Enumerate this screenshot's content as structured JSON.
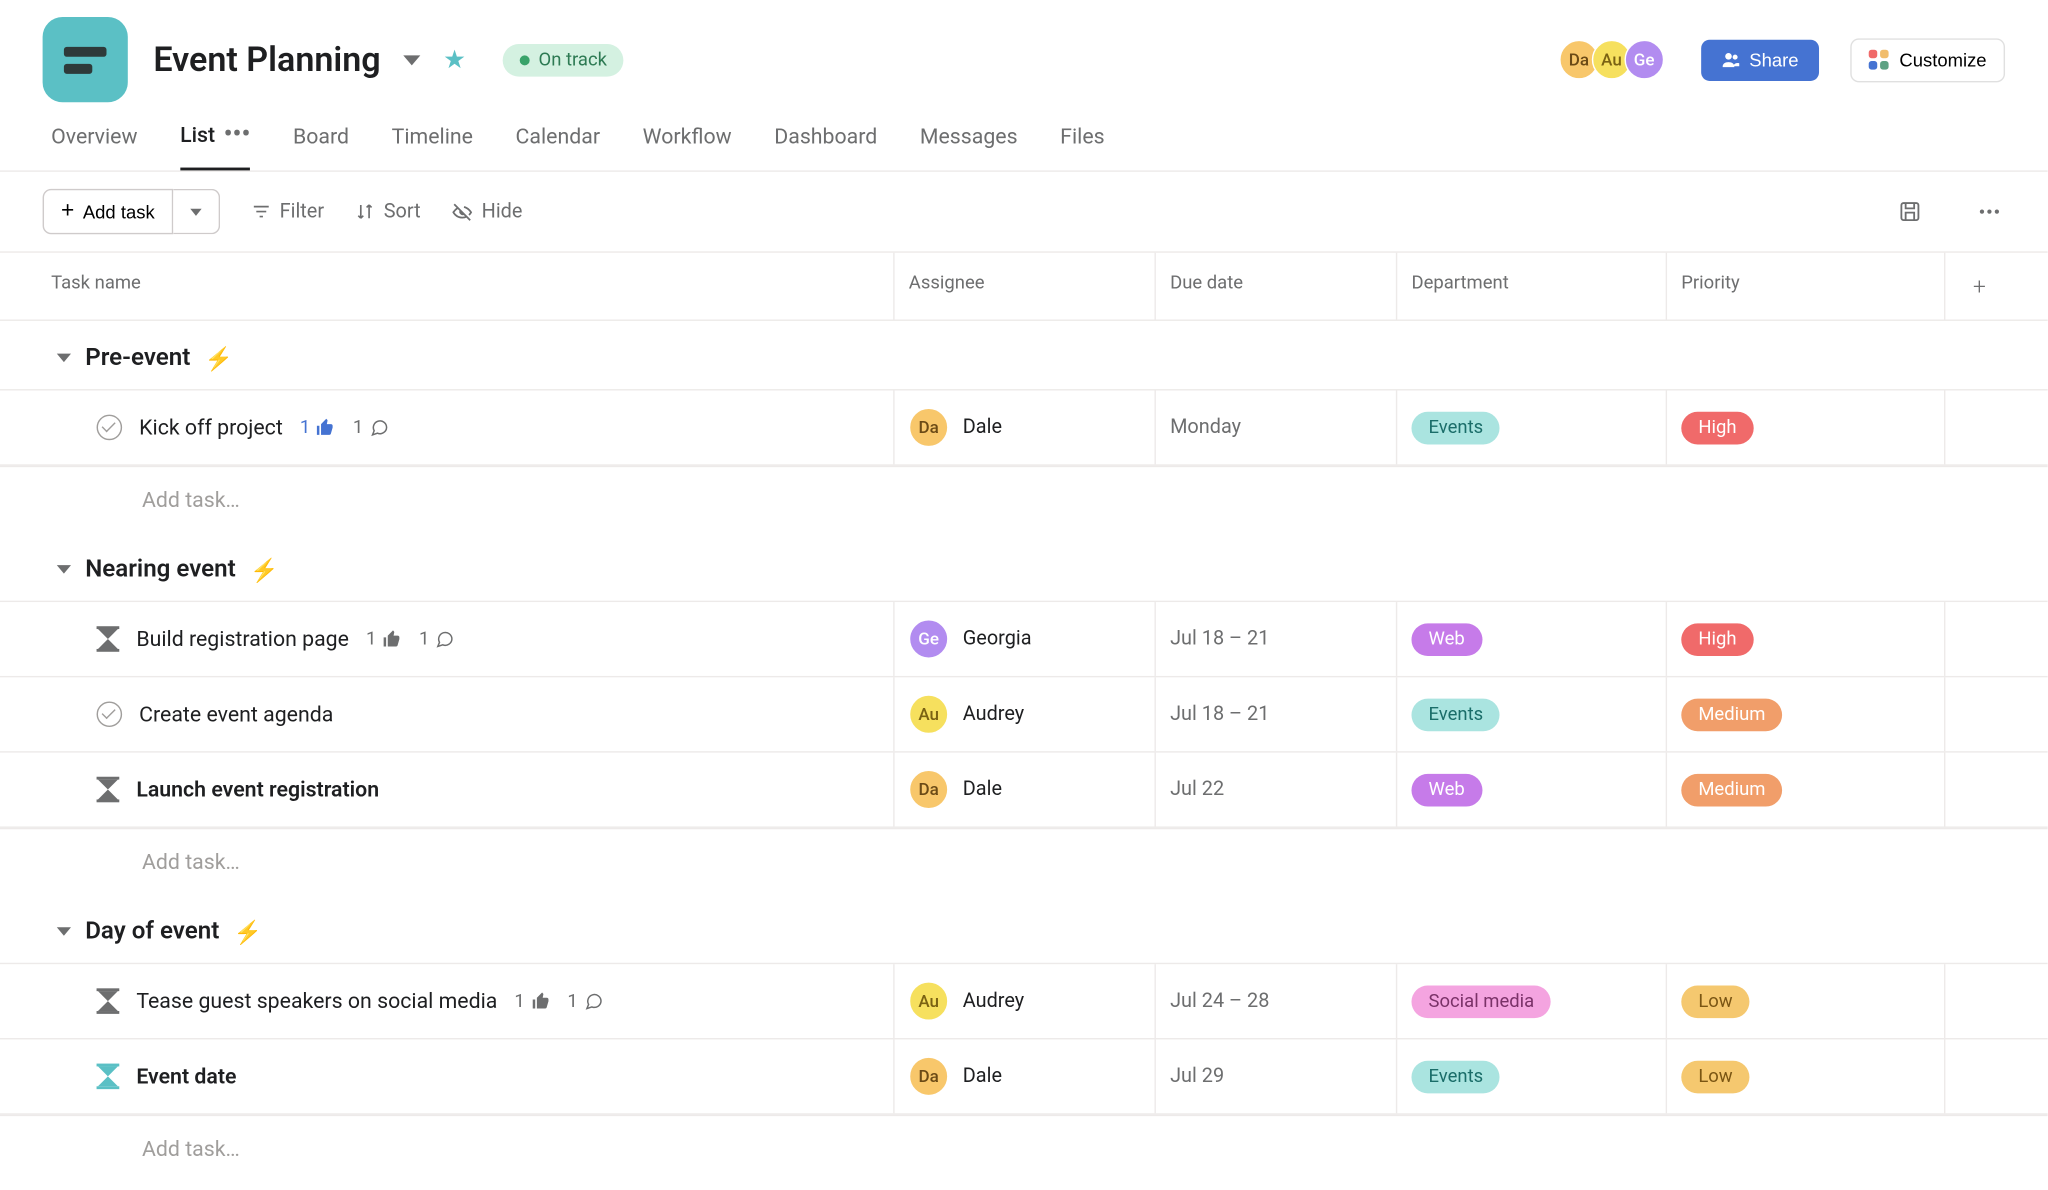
{
  "project": {
    "title": "Event Planning",
    "status": "On track"
  },
  "members": [
    {
      "initials": "Da",
      "class": "av-da"
    },
    {
      "initials": "Au",
      "class": "av-au"
    },
    {
      "initials": "Ge",
      "class": "av-ge"
    }
  ],
  "buttons": {
    "share": "Share",
    "customize": "Customize",
    "add_task": "Add task"
  },
  "tabs": [
    {
      "label": "Overview",
      "active": false
    },
    {
      "label": "List",
      "active": true
    },
    {
      "label": "Board",
      "active": false
    },
    {
      "label": "Timeline",
      "active": false
    },
    {
      "label": "Calendar",
      "active": false
    },
    {
      "label": "Workflow",
      "active": false
    },
    {
      "label": "Dashboard",
      "active": false
    },
    {
      "label": "Messages",
      "active": false
    },
    {
      "label": "Files",
      "active": false
    }
  ],
  "toolbar": {
    "filter": "Filter",
    "sort": "Sort",
    "hide": "Hide"
  },
  "columns": {
    "task": "Task name",
    "assignee": "Assignee",
    "due": "Due date",
    "dept": "Department",
    "priority": "Priority"
  },
  "add_task_placeholder": "Add task…",
  "sections": [
    {
      "title": "Pre-event",
      "tasks": [
        {
          "icon": "check",
          "name": "Kick off project",
          "bold": false,
          "likes": "1",
          "like_blue": true,
          "comments": "1",
          "assignee": {
            "initials": "Da",
            "class": "av-da",
            "name": "Dale"
          },
          "due": "Monday",
          "dept": {
            "label": "Events",
            "class": "tag-events"
          },
          "priority": {
            "label": "High",
            "class": "tag-high"
          }
        }
      ]
    },
    {
      "title": "Nearing event",
      "tasks": [
        {
          "icon": "hourglass",
          "name": "Build registration page",
          "bold": false,
          "likes": "1",
          "like_blue": false,
          "comments": "1",
          "assignee": {
            "initials": "Ge",
            "class": "av-ge",
            "name": "Georgia"
          },
          "due": "Jul 18 – 21",
          "dept": {
            "label": "Web",
            "class": "tag-web"
          },
          "priority": {
            "label": "High",
            "class": "tag-high"
          }
        },
        {
          "icon": "check",
          "name": "Create event agenda",
          "bold": false,
          "likes": null,
          "comments": null,
          "assignee": {
            "initials": "Au",
            "class": "av-au",
            "name": "Audrey"
          },
          "due": "Jul 18 – 21",
          "dept": {
            "label": "Events",
            "class": "tag-events"
          },
          "priority": {
            "label": "Medium",
            "class": "tag-medium"
          }
        },
        {
          "icon": "hourglass",
          "name": "Launch event registration",
          "bold": true,
          "likes": null,
          "comments": null,
          "assignee": {
            "initials": "Da",
            "class": "av-da",
            "name": "Dale"
          },
          "due": "Jul 22",
          "dept": {
            "label": "Web",
            "class": "tag-web"
          },
          "priority": {
            "label": "Medium",
            "class": "tag-medium"
          }
        }
      ]
    },
    {
      "title": "Day of event",
      "tasks": [
        {
          "icon": "hourglass",
          "name": "Tease guest speakers on social media",
          "bold": false,
          "likes": "1",
          "like_blue": false,
          "comments": "1",
          "assignee": {
            "initials": "Au",
            "class": "av-au",
            "name": "Audrey"
          },
          "due": "Jul 24 – 28",
          "dept": {
            "label": "Social media",
            "class": "tag-social"
          },
          "priority": {
            "label": "Low",
            "class": "tag-low"
          }
        },
        {
          "icon": "hourglass-active",
          "name": "Event date",
          "bold": true,
          "likes": null,
          "comments": null,
          "assignee": {
            "initials": "Da",
            "class": "av-da",
            "name": "Dale"
          },
          "due": "Jul 29",
          "dept": {
            "label": "Events",
            "class": "tag-events"
          },
          "priority": {
            "label": "Low",
            "class": "tag-low"
          }
        }
      ]
    }
  ]
}
